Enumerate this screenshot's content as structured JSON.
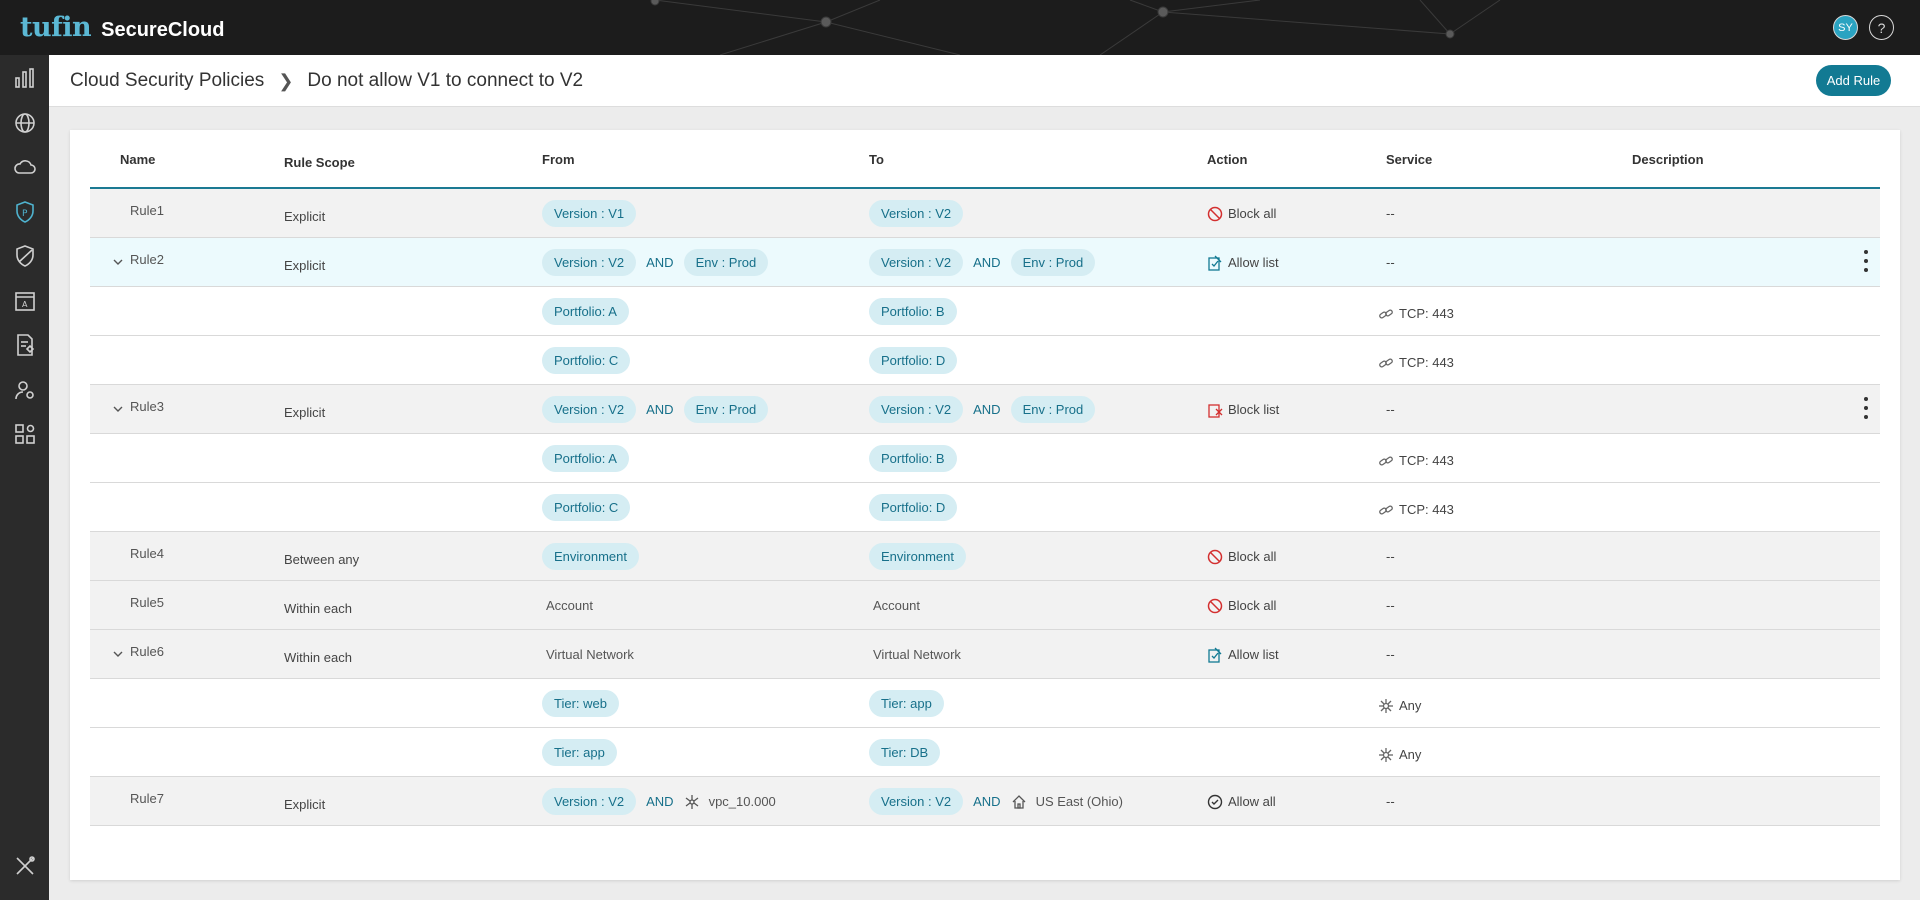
{
  "app": {
    "brand": "tufin",
    "product": "SecureCloud",
    "user_initials": "SY",
    "help_glyph": "?"
  },
  "breadcrumb": {
    "parent": "Cloud Security Policies",
    "current": "Do not allow V1 to connect to V2"
  },
  "toolbar": {
    "add_rule_label": "Add Rule"
  },
  "sidebar": {
    "items": [
      {
        "icon": "bar-chart-icon"
      },
      {
        "icon": "globe-icon"
      },
      {
        "icon": "cloud-icon"
      },
      {
        "icon": "policy-shield-icon",
        "active": true
      },
      {
        "icon": "shield-slash-icon"
      },
      {
        "icon": "app-window-icon"
      },
      {
        "icon": "document-tag-icon"
      },
      {
        "icon": "user-settings-icon"
      },
      {
        "icon": "grid-settings-icon"
      },
      {
        "icon": "tools-icon"
      }
    ]
  },
  "columns": [
    "Name",
    "Rule Scope",
    "From",
    "To",
    "Action",
    "Service",
    "Description"
  ],
  "colors": {
    "accent": "#127a93",
    "tag_bg": "#d5edf3",
    "tag_text": "#17708a",
    "block": "#d32f2f",
    "topbar": "#1c1c1c"
  },
  "rows": [
    {
      "name": "Rule1",
      "scope": "Explicit",
      "from": [
        {
          "t": "tag",
          "v": "Version : V1"
        }
      ],
      "to": [
        {
          "t": "tag",
          "v": "Version : V2"
        }
      ],
      "action": {
        "icon": "block",
        "label": "Block all"
      },
      "service": {
        "label": "--"
      },
      "bg": "gray"
    },
    {
      "name": "Rule2",
      "expand": true,
      "kebab": true,
      "scope": "Explicit",
      "from": [
        {
          "t": "tag",
          "v": "Version : V2"
        },
        {
          "t": "and",
          "v": "AND"
        },
        {
          "t": "tag",
          "v": "Env : Prod"
        }
      ],
      "to": [
        {
          "t": "tag",
          "v": "Version : V2"
        },
        {
          "t": "and",
          "v": "AND"
        },
        {
          "t": "tag",
          "v": "Env : Prod"
        }
      ],
      "action": {
        "icon": "allowlist",
        "label": "Allow list"
      },
      "service": {
        "label": "--"
      },
      "bg": "hl"
    },
    {
      "from": [
        {
          "t": "tag",
          "v": "Portfolio: A"
        }
      ],
      "to": [
        {
          "t": "tag",
          "v": "Portfolio: B"
        }
      ],
      "service": {
        "icon": "link",
        "label": "TCP: 443"
      },
      "bg": "white"
    },
    {
      "from": [
        {
          "t": "tag",
          "v": "Portfolio: C"
        }
      ],
      "to": [
        {
          "t": "tag",
          "v": "Portfolio: D"
        }
      ],
      "service": {
        "icon": "link",
        "label": "TCP: 443"
      },
      "bg": "white"
    },
    {
      "name": "Rule3",
      "expand": true,
      "kebab": true,
      "scope": "Explicit",
      "from": [
        {
          "t": "tag",
          "v": "Version : V2"
        },
        {
          "t": "and",
          "v": "AND"
        },
        {
          "t": "tag",
          "v": "Env : Prod"
        }
      ],
      "to": [
        {
          "t": "tag",
          "v": "Version : V2"
        },
        {
          "t": "and",
          "v": "AND"
        },
        {
          "t": "tag",
          "v": "Env : Prod"
        }
      ],
      "action": {
        "icon": "blocklist",
        "label": "Block list"
      },
      "service": {
        "label": "--"
      },
      "bg": "gray"
    },
    {
      "from": [
        {
          "t": "tag",
          "v": "Portfolio: A"
        }
      ],
      "to": [
        {
          "t": "tag",
          "v": "Portfolio: B"
        }
      ],
      "service": {
        "icon": "link",
        "label": "TCP: 443"
      },
      "bg": "white"
    },
    {
      "from": [
        {
          "t": "tag",
          "v": "Portfolio: C"
        }
      ],
      "to": [
        {
          "t": "tag",
          "v": "Portfolio: D"
        }
      ],
      "service": {
        "icon": "link",
        "label": "TCP: 443"
      },
      "bg": "white"
    },
    {
      "name": "Rule4",
      "scope": "Between any",
      "from": [
        {
          "t": "tag",
          "v": "Environment"
        }
      ],
      "to": [
        {
          "t": "tag",
          "v": "Environment"
        }
      ],
      "action": {
        "icon": "block",
        "label": "Block all"
      },
      "service": {
        "label": "--"
      },
      "bg": "gray"
    },
    {
      "name": "Rule5",
      "scope": "Within each",
      "from": [
        {
          "t": "plain",
          "v": "Account"
        }
      ],
      "to": [
        {
          "t": "plain",
          "v": "Account"
        }
      ],
      "action": {
        "icon": "block",
        "label": "Block all"
      },
      "service": {
        "label": "--"
      },
      "bg": "gray"
    },
    {
      "name": "Rule6",
      "expand": true,
      "scope": "Within each",
      "from": [
        {
          "t": "plain",
          "v": "Virtual Network"
        }
      ],
      "to": [
        {
          "t": "plain",
          "v": "Virtual Network"
        }
      ],
      "action": {
        "icon": "allowlist",
        "label": "Allow list"
      },
      "service": {
        "label": "--"
      },
      "bg": "gray"
    },
    {
      "from": [
        {
          "t": "tag",
          "v": "Tier: web"
        }
      ],
      "to": [
        {
          "t": "tag",
          "v": "Tier: app"
        }
      ],
      "service": {
        "icon": "any",
        "label": "Any"
      },
      "bg": "white"
    },
    {
      "from": [
        {
          "t": "tag",
          "v": "Tier: app"
        }
      ],
      "to": [
        {
          "t": "tag",
          "v": "Tier: DB"
        }
      ],
      "service": {
        "icon": "any",
        "label": "Any"
      },
      "bg": "white"
    },
    {
      "name": "Rule7",
      "scope": "Explicit",
      "from": [
        {
          "t": "tag",
          "v": "Version : V2"
        },
        {
          "t": "and",
          "v": "AND"
        },
        {
          "t": "vpc",
          "v": "vpc_10.000"
        }
      ],
      "to": [
        {
          "t": "tag",
          "v": "Version : V2"
        },
        {
          "t": "and",
          "v": "AND"
        },
        {
          "t": "region",
          "v": "US East (Ohio)"
        }
      ],
      "action": {
        "icon": "allowall",
        "label": "Allow all"
      },
      "service": {
        "label": "--"
      },
      "bg": "gray"
    }
  ]
}
